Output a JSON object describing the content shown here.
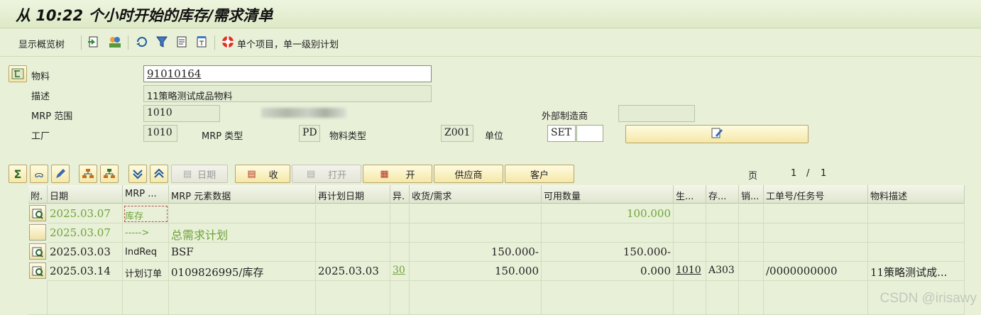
{
  "title": "从 10:22 个小时开始的库存/需求清单",
  "toolbar": {
    "overview_tree": "显示概览树",
    "single_item_plan": "单个项目，单一级别计划"
  },
  "header": {
    "material_label": "物料",
    "material_value": "91010164",
    "desc_label": "描述",
    "desc_value": "11策略测试成品物料",
    "mrp_area_label": "MRP 范围",
    "mrp_area_value": "1010",
    "ext_mfr_label": "外部制造商",
    "ext_mfr_value": "",
    "plant_label": "工厂",
    "plant_value": "1010",
    "mrp_type_label": "MRP 类型",
    "mrp_type_value": "PD",
    "mat_type_label": "物料类型",
    "mat_type_value": "Z001",
    "unit_label": "单位",
    "unit_value": "SET"
  },
  "buttons": {
    "date": "日期",
    "receipt": "收",
    "open": "打开",
    "open2": "开",
    "supplier": "供应商",
    "customer": "客户",
    "page_label": "页",
    "page_current": "1",
    "page_sep": "/",
    "page_total": "1"
  },
  "table": {
    "columns": [
      "附.",
      "日期",
      "MRP ...",
      "MRP 元素数据",
      "再计划日期",
      "异.",
      "收货/需求",
      "可用数量",
      "生...",
      "存...",
      "销...",
      "工单号/任务号",
      "物料描述"
    ],
    "rows": [
      {
        "date": "2025.03.07",
        "mrp": "库存",
        "data": "",
        "resched": "",
        "exc": "",
        "qty": "",
        "avail": "100.000",
        "prod": "",
        "stor": "",
        "sales": "",
        "order": "",
        "desc": "",
        "style": "green"
      },
      {
        "date": "2025.03.07",
        "mrp": "----->",
        "data": "总需求计划",
        "resched": "",
        "exc": "",
        "qty": "",
        "avail": "",
        "prod": "",
        "stor": "",
        "sales": "",
        "order": "",
        "desc": "",
        "style": "green"
      },
      {
        "date": "2025.03.03",
        "mrp": "IndReq",
        "data": "BSF",
        "resched": "",
        "exc": "",
        "qty": "150.000-",
        "avail": "150.000-",
        "prod": "",
        "stor": "",
        "sales": "",
        "order": "",
        "desc": "",
        "style": "normal"
      },
      {
        "date": "2025.03.14",
        "mrp": "计划订单",
        "data": "0109826995/库存",
        "resched": "2025.03.03",
        "exc": "30",
        "qty": "150.000",
        "avail": "0.000",
        "prod": "1010",
        "stor": "A303",
        "sales": "",
        "order": "/0000000000",
        "desc": "11策略测试成...",
        "style": "normal"
      }
    ]
  },
  "watermark": "CSDN @irisawy"
}
